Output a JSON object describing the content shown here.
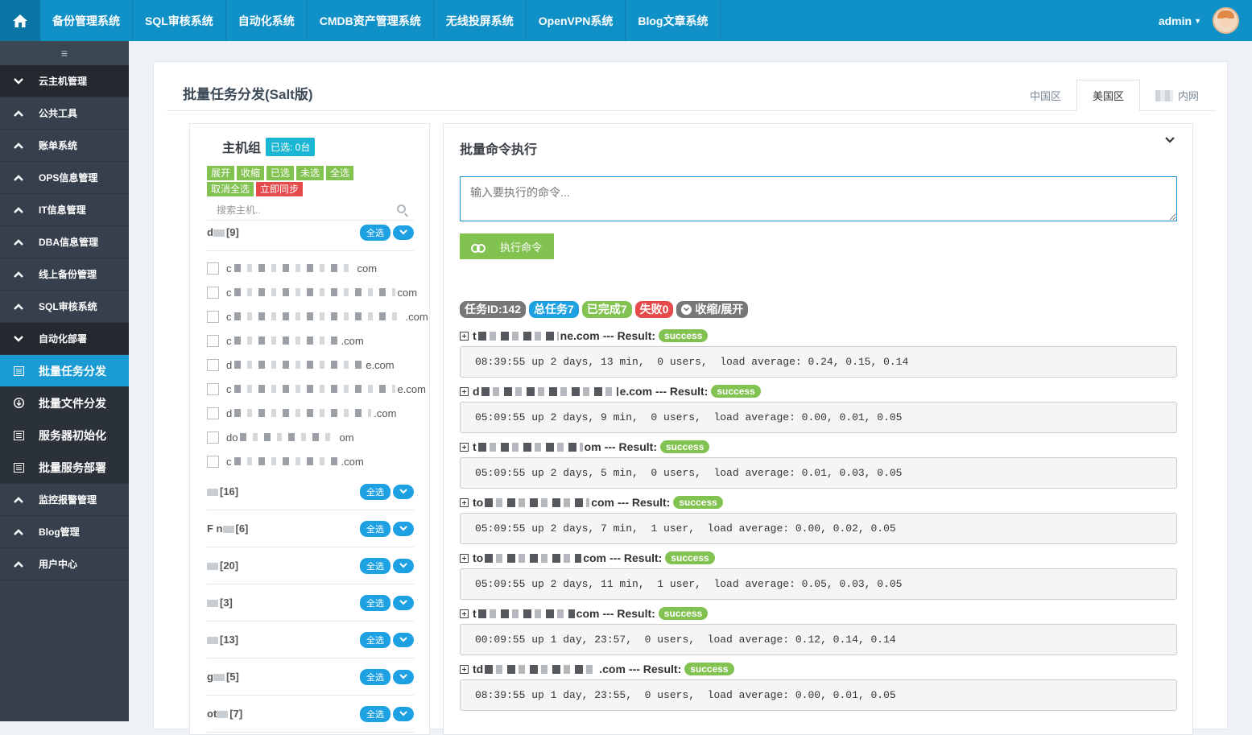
{
  "topnav": {
    "items": [
      "备份管理系统",
      "SQL审核系统",
      "自动化系统",
      "CMDB资产管理系统",
      "无线投屏系统",
      "OpenVPN系统",
      "Blog文章系统"
    ],
    "user": "admin"
  },
  "sidebar": {
    "toggle": "≡",
    "items": [
      {
        "label": "云主机管理",
        "icon": "chevron-down"
      },
      {
        "label": "公共工具",
        "icon": "chevron-up"
      },
      {
        "label": "账单系统",
        "icon": "chevron-up"
      },
      {
        "label": "OPS信息管理",
        "icon": "chevron-up"
      },
      {
        "label": "IT信息管理",
        "icon": "chevron-up"
      },
      {
        "label": "DBA信息管理",
        "icon": "chevron-up"
      },
      {
        "label": "线上备份管理",
        "icon": "chevron-up"
      },
      {
        "label": "SQL审核系统",
        "icon": "chevron-up"
      },
      {
        "label": "自动化部署",
        "icon": "chevron-down"
      },
      {
        "label": "批量任务分发",
        "icon": "list"
      },
      {
        "label": "批量文件分发",
        "icon": "download"
      },
      {
        "label": "服务器初始化",
        "icon": "list"
      },
      {
        "label": "批量服务部署",
        "icon": "list"
      },
      {
        "label": "监控报警管理",
        "icon": "chevron-up"
      },
      {
        "label": "Blog管理",
        "icon": "chevron-up"
      },
      {
        "label": "用户中心",
        "icon": "chevron-up"
      }
    ]
  },
  "page": {
    "title": "批量任务分发(Salt版)",
    "tabs": [
      "中国区",
      "美国区",
      "内网"
    ]
  },
  "hostgroup": {
    "title": "主机组",
    "selected_badge": "已选: 0台",
    "buttons": [
      "展开",
      "收缩",
      "已选",
      "未选",
      "全选",
      "取消全选"
    ],
    "sync_button": "立即同步",
    "search_placeholder": "搜索主机..",
    "select_all": "全选",
    "groups": [
      {
        "name": "d",
        "count": "[9]"
      },
      {
        "name": "",
        "count": "[16]"
      },
      {
        "name": "F  n",
        "count": "[6]"
      },
      {
        "name": "",
        "count": "[20]"
      },
      {
        "name": "",
        "count": "[3]"
      },
      {
        "name": "",
        "count": "[13]"
      },
      {
        "name": "g",
        "count": "[5]"
      },
      {
        "name": "ot",
        "count": "[7]"
      }
    ],
    "hosts": [
      {
        "prefix": "c",
        "suffix": "com"
      },
      {
        "prefix": "c",
        "suffix": "com"
      },
      {
        "prefix": "c",
        "suffix": ".com"
      },
      {
        "prefix": "c",
        "suffix": ".com"
      },
      {
        "prefix": "d",
        "suffix": "e.com"
      },
      {
        "prefix": "c",
        "suffix": "e.com"
      },
      {
        "prefix": "d",
        "suffix": ".com"
      },
      {
        "prefix": "do",
        "suffix": "om"
      },
      {
        "prefix": "c",
        "suffix": ".com"
      }
    ]
  },
  "command": {
    "title": "批量命令执行",
    "placeholder": "输入要执行的命令...",
    "run_button": "执行命令",
    "stats": {
      "task_id": "任务ID:142",
      "total": "总任务7",
      "done": "已完成7",
      "failed": "失败0",
      "toggle": "收缩/展开"
    },
    "results": [
      {
        "host_prefix": "t",
        "host_suffix": "ne.com",
        "result_label": "--- Result:",
        "status": "success",
        "output": "08:39:55 up 2 days, 13 min,  0 users,  load average: 0.24, 0.15, 0.14"
      },
      {
        "host_prefix": "d",
        "host_suffix": "e.com",
        "result_label": "--- Result:",
        "status": "success",
        "output": "05:09:55 up 2 days, 9 min,  0 users,  load average: 0.00, 0.01, 0.05"
      },
      {
        "host_prefix": "t",
        "host_suffix": "om",
        "result_label": "--- Result:",
        "status": "success",
        "output": "05:09:55 up 2 days, 5 min,  0 users,  load average: 0.01, 0.03, 0.05"
      },
      {
        "host_prefix": "to",
        "host_suffix": "com",
        "result_label": "--- Result:",
        "status": "success",
        "output": "05:09:55 up 2 days, 7 min,  1 user,  load average: 0.00, 0.02, 0.05"
      },
      {
        "host_prefix": "to",
        "host_suffix": "com",
        "result_label": "--- Result:",
        "status": "success",
        "output": "05:09:55 up 2 days, 11 min,  1 user,  load average: 0.05, 0.03, 0.05"
      },
      {
        "host_prefix": "t",
        "host_suffix": "com",
        "result_label": "--- Result:",
        "status": "success",
        "output": "00:09:55 up 1 day, 23:57,  0 users,  load average: 0.12, 0.14, 0.14"
      },
      {
        "host_prefix": "td",
        "host_suffix": ".com",
        "result_label": "--- Result:",
        "status": "success",
        "output": "08:39:55 up 1 day, 23:55,  0 users,  load average: 0.00, 0.01, 0.05"
      }
    ]
  }
}
